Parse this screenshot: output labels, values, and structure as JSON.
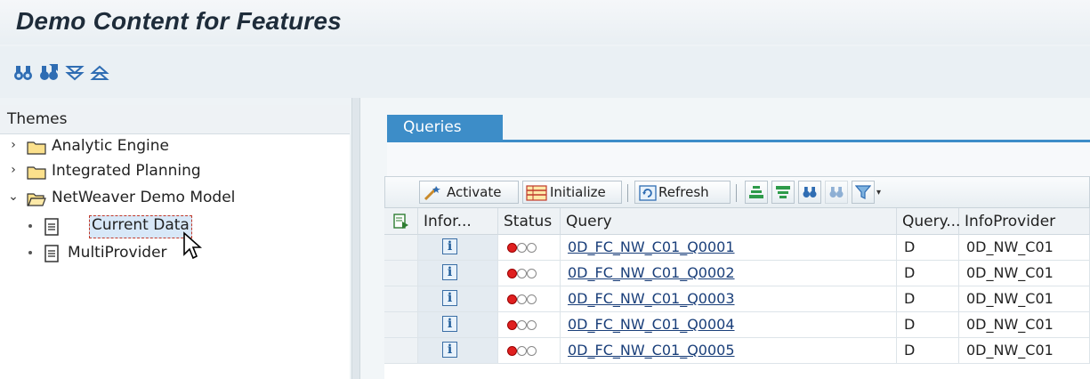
{
  "header": {
    "title": "Demo Content for Features"
  },
  "app_toolbar": {
    "icons": [
      "find-icon",
      "find-next-icon",
      "expand-all-icon",
      "collapse-all-icon"
    ]
  },
  "themes": {
    "header": "Themes",
    "items": [
      {
        "label": "Analytic Engine",
        "state": "collapsed"
      },
      {
        "label": "Integrated Planning",
        "state": "collapsed"
      },
      {
        "label": "NetWeaver Demo Model",
        "state": "expanded",
        "children": [
          {
            "label": "Current Data",
            "selected": true
          },
          {
            "label": "MultiProvider",
            "selected": false
          }
        ]
      }
    ]
  },
  "tabs": [
    {
      "label": "Queries",
      "active": true
    }
  ],
  "grid_toolbar": {
    "activate": "Activate",
    "initialize": "Initialize",
    "refresh": "Refresh"
  },
  "table": {
    "columns": [
      "Infor...",
      "Status",
      "Query",
      "Query...",
      "InfoProvider"
    ],
    "rows": [
      {
        "query": "0D_FC_NW_C01_Q0001",
        "type": "D",
        "provider": "0D_NW_C01",
        "status": "red"
      },
      {
        "query": "0D_FC_NW_C01_Q0002",
        "type": "D",
        "provider": "0D_NW_C01",
        "status": "red"
      },
      {
        "query": "0D_FC_NW_C01_Q0003",
        "type": "D",
        "provider": "0D_NW_C01",
        "status": "red"
      },
      {
        "query": "0D_FC_NW_C01_Q0004",
        "type": "D",
        "provider": "0D_NW_C01",
        "status": "red"
      },
      {
        "query": "0D_FC_NW_C01_Q0005",
        "type": "D",
        "provider": "0D_NW_C01",
        "status": "red"
      }
    ]
  },
  "colors": {
    "tab_blue": "#3d8dc8",
    "link": "#1a3f7a",
    "status_red": "#e02020"
  }
}
